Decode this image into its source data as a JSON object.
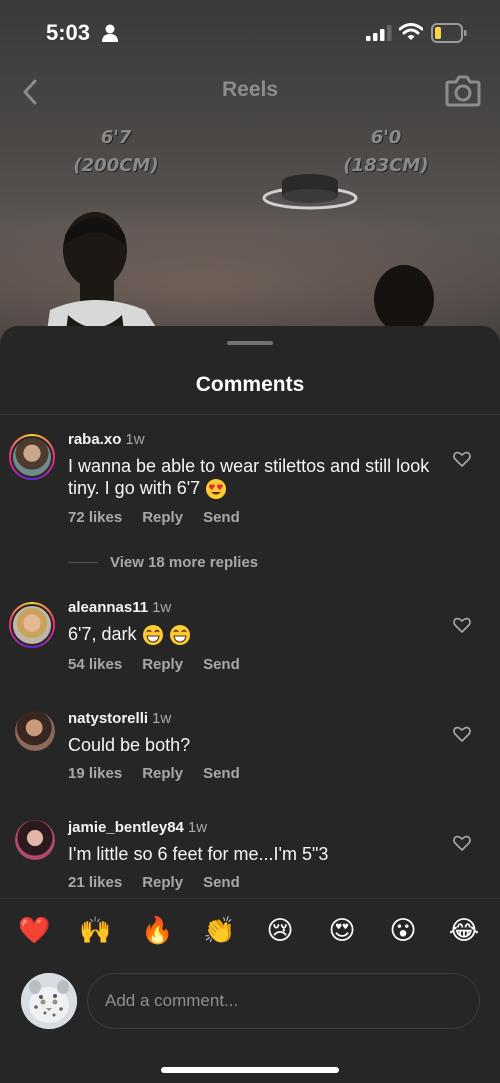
{
  "status_bar": {
    "time": "5:03"
  },
  "header": {
    "title": "Reels"
  },
  "video": {
    "left_label_line1": "6'7",
    "left_label_line2": "(200CM)",
    "right_label_line1": "6'0",
    "right_label_line2": "(183CM)"
  },
  "comments_sheet": {
    "title": "Comments",
    "comments": [
      {
        "username": "raba.xo",
        "ago": "1w",
        "text": "I wanna be able to wear stilettos and still look tiny. I go with 6'7",
        "likes": "72 likes",
        "reply": "Reply",
        "send": "Send",
        "view_replies": "View 18 more replies"
      },
      {
        "username": "aleannas11",
        "ago": "1w",
        "text": "6'7, dark",
        "likes": "54 likes",
        "reply": "Reply",
        "send": "Send"
      },
      {
        "username": "natystorelli",
        "ago": "1w",
        "text": "Could be both?",
        "likes": "19 likes",
        "reply": "Reply",
        "send": "Send"
      },
      {
        "username": "jamie_bentley84",
        "ago": "1w",
        "text": "I'm little so 6 feet for me...I'm 5\"3",
        "likes": "21 likes",
        "reply": "Reply",
        "send": "Send"
      }
    ]
  },
  "emoji_bar": [
    "❤️",
    "🙌",
    "🔥",
    "👏",
    "😢",
    "😍",
    "😮",
    "😂"
  ],
  "composer": {
    "placeholder": "Add a comment..."
  },
  "icons": {
    "status": [
      "person-icon",
      "signal-icon",
      "wifi-icon",
      "battery-icon"
    ],
    "header": [
      "back-chevron-icon",
      "camera-icon"
    ],
    "comment": "heart-outline-icon"
  },
  "colors": {
    "sheet_background": "#262626",
    "secondary_text": "#a8a8a8",
    "battery_level": "#f7d547"
  }
}
